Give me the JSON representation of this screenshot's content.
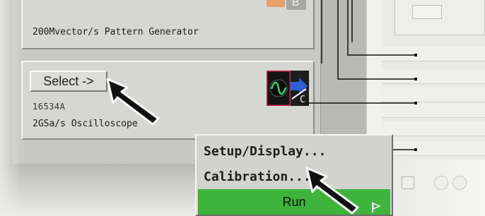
{
  "modules": {
    "top": {
      "description": "200Mvector/s Pattern Generator",
      "badge_letter": "B"
    },
    "middle": {
      "select_label": "Select ->",
      "part_number": "16534A",
      "description": "2GSa/s Oscilloscope",
      "badge_letter": "C"
    }
  },
  "context_menu": {
    "items": [
      {
        "label": "Setup/Display..."
      },
      {
        "label": "Calibration..."
      },
      {
        "label": "Run"
      }
    ]
  },
  "colors": {
    "run_highlight": "#3fb43c",
    "module_icon_border": "#c0284a",
    "module_icon_arrow": "#2f5fd6",
    "badge_orange": "#e8a06a"
  },
  "icons": {
    "module_icon": "oscilloscope-wave-icon",
    "run_icon": "flag-icon",
    "cursor": "arrow-cursor-icon"
  }
}
